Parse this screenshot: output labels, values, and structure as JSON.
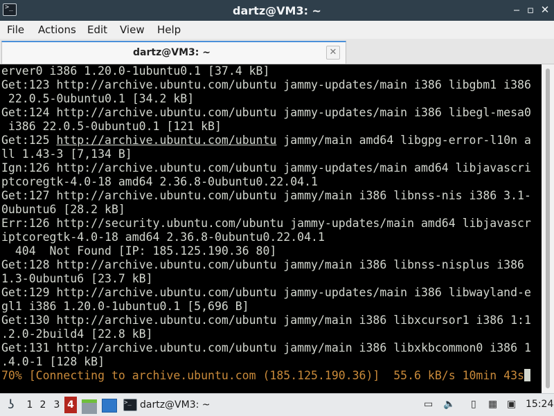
{
  "window": {
    "title": "dartz@VM3: ~",
    "app_icon_glyph": ">_",
    "minimize_glyph": "‒",
    "maximize_glyph": "▫",
    "close_glyph": "✕"
  },
  "menubar": {
    "items": [
      "File",
      "Actions",
      "Edit",
      "View",
      "Help"
    ]
  },
  "tabs": [
    {
      "label": "dartz@VM3: ~",
      "close_glyph": "✕"
    }
  ],
  "terminal": {
    "lines": [
      "erver0 i386 1.20.0-1ubuntu0.1 [37.4 kB]",
      "Get:123 http://archive.ubuntu.com/ubuntu jammy-updates/main i386 libgbm1 i386",
      " 22.0.5-0ubuntu0.1 [34.2 kB]",
      "Get:124 http://archive.ubuntu.com/ubuntu jammy-updates/main i386 libegl-mesa0",
      " i386 22.0.5-0ubuntu0.1 [121 kB]",
      "Get:125 http://archive.ubuntu.com/ubuntu jammy/main amd64 libgpg-error-l10n a",
      "ll 1.43-3 [7,134 B]",
      "Ign:126 http://archive.ubuntu.com/ubuntu jammy-updates/main amd64 libjavascri",
      "ptcoregtk-4.0-18 amd64 2.36.8-0ubuntu0.22.04.1",
      "Get:127 http://archive.ubuntu.com/ubuntu jammy/main i386 libnss-nis i386 3.1-",
      "0ubuntu6 [28.2 kB]",
      "Err:126 http://security.ubuntu.com/ubuntu jammy-updates/main amd64 libjavascr",
      "iptcoregtk-4.0-18 amd64 2.36.8-0ubuntu0.22.04.1",
      "  404  Not Found [IP: 185.125.190.36 80]",
      "Get:128 http://archive.ubuntu.com/ubuntu jammy/main i386 libnss-nisplus i386",
      "1.3-0ubuntu6 [23.7 kB]",
      "Get:129 http://archive.ubuntu.com/ubuntu jammy-updates/main i386 libwayland-e",
      "gl1 i386 1.20.0-1ubuntu0.1 [5,696 B]",
      "Get:130 http://archive.ubuntu.com/ubuntu jammy/main i386 libxcursor1 i386 1:1",
      ".2.0-2build4 [22.8 kB]",
      "Get:131 http://archive.ubuntu.com/ubuntu jammy/main i386 libxkbcommon0 i386 1",
      ".4.0-1 [128 kB]"
    ],
    "link_line_prefix": "Get:125 ",
    "link_text": "http://archive.ubuntu.com/ubuntu",
    "link_line_suffix": " jammy/main amd64 libgpg-error-l10n a",
    "progress_line": "70% [Connecting to archive.ubuntu.com (185.125.190.36)]  55.6 kB/s 10min 43s",
    "progress_color": "#c98a3a"
  },
  "taskbar": {
    "start_glyph": "ʖ",
    "workspaces": [
      "1",
      "2",
      "3",
      "4"
    ],
    "active_workspace": "4",
    "task_label": "dartz@VM3: ~",
    "tray_glyphs": {
      "screen": "▭",
      "volume": "🔈",
      "clipboard": "▯",
      "keyboard": "▦",
      "updates": "▣"
    },
    "clock": "15:24"
  }
}
